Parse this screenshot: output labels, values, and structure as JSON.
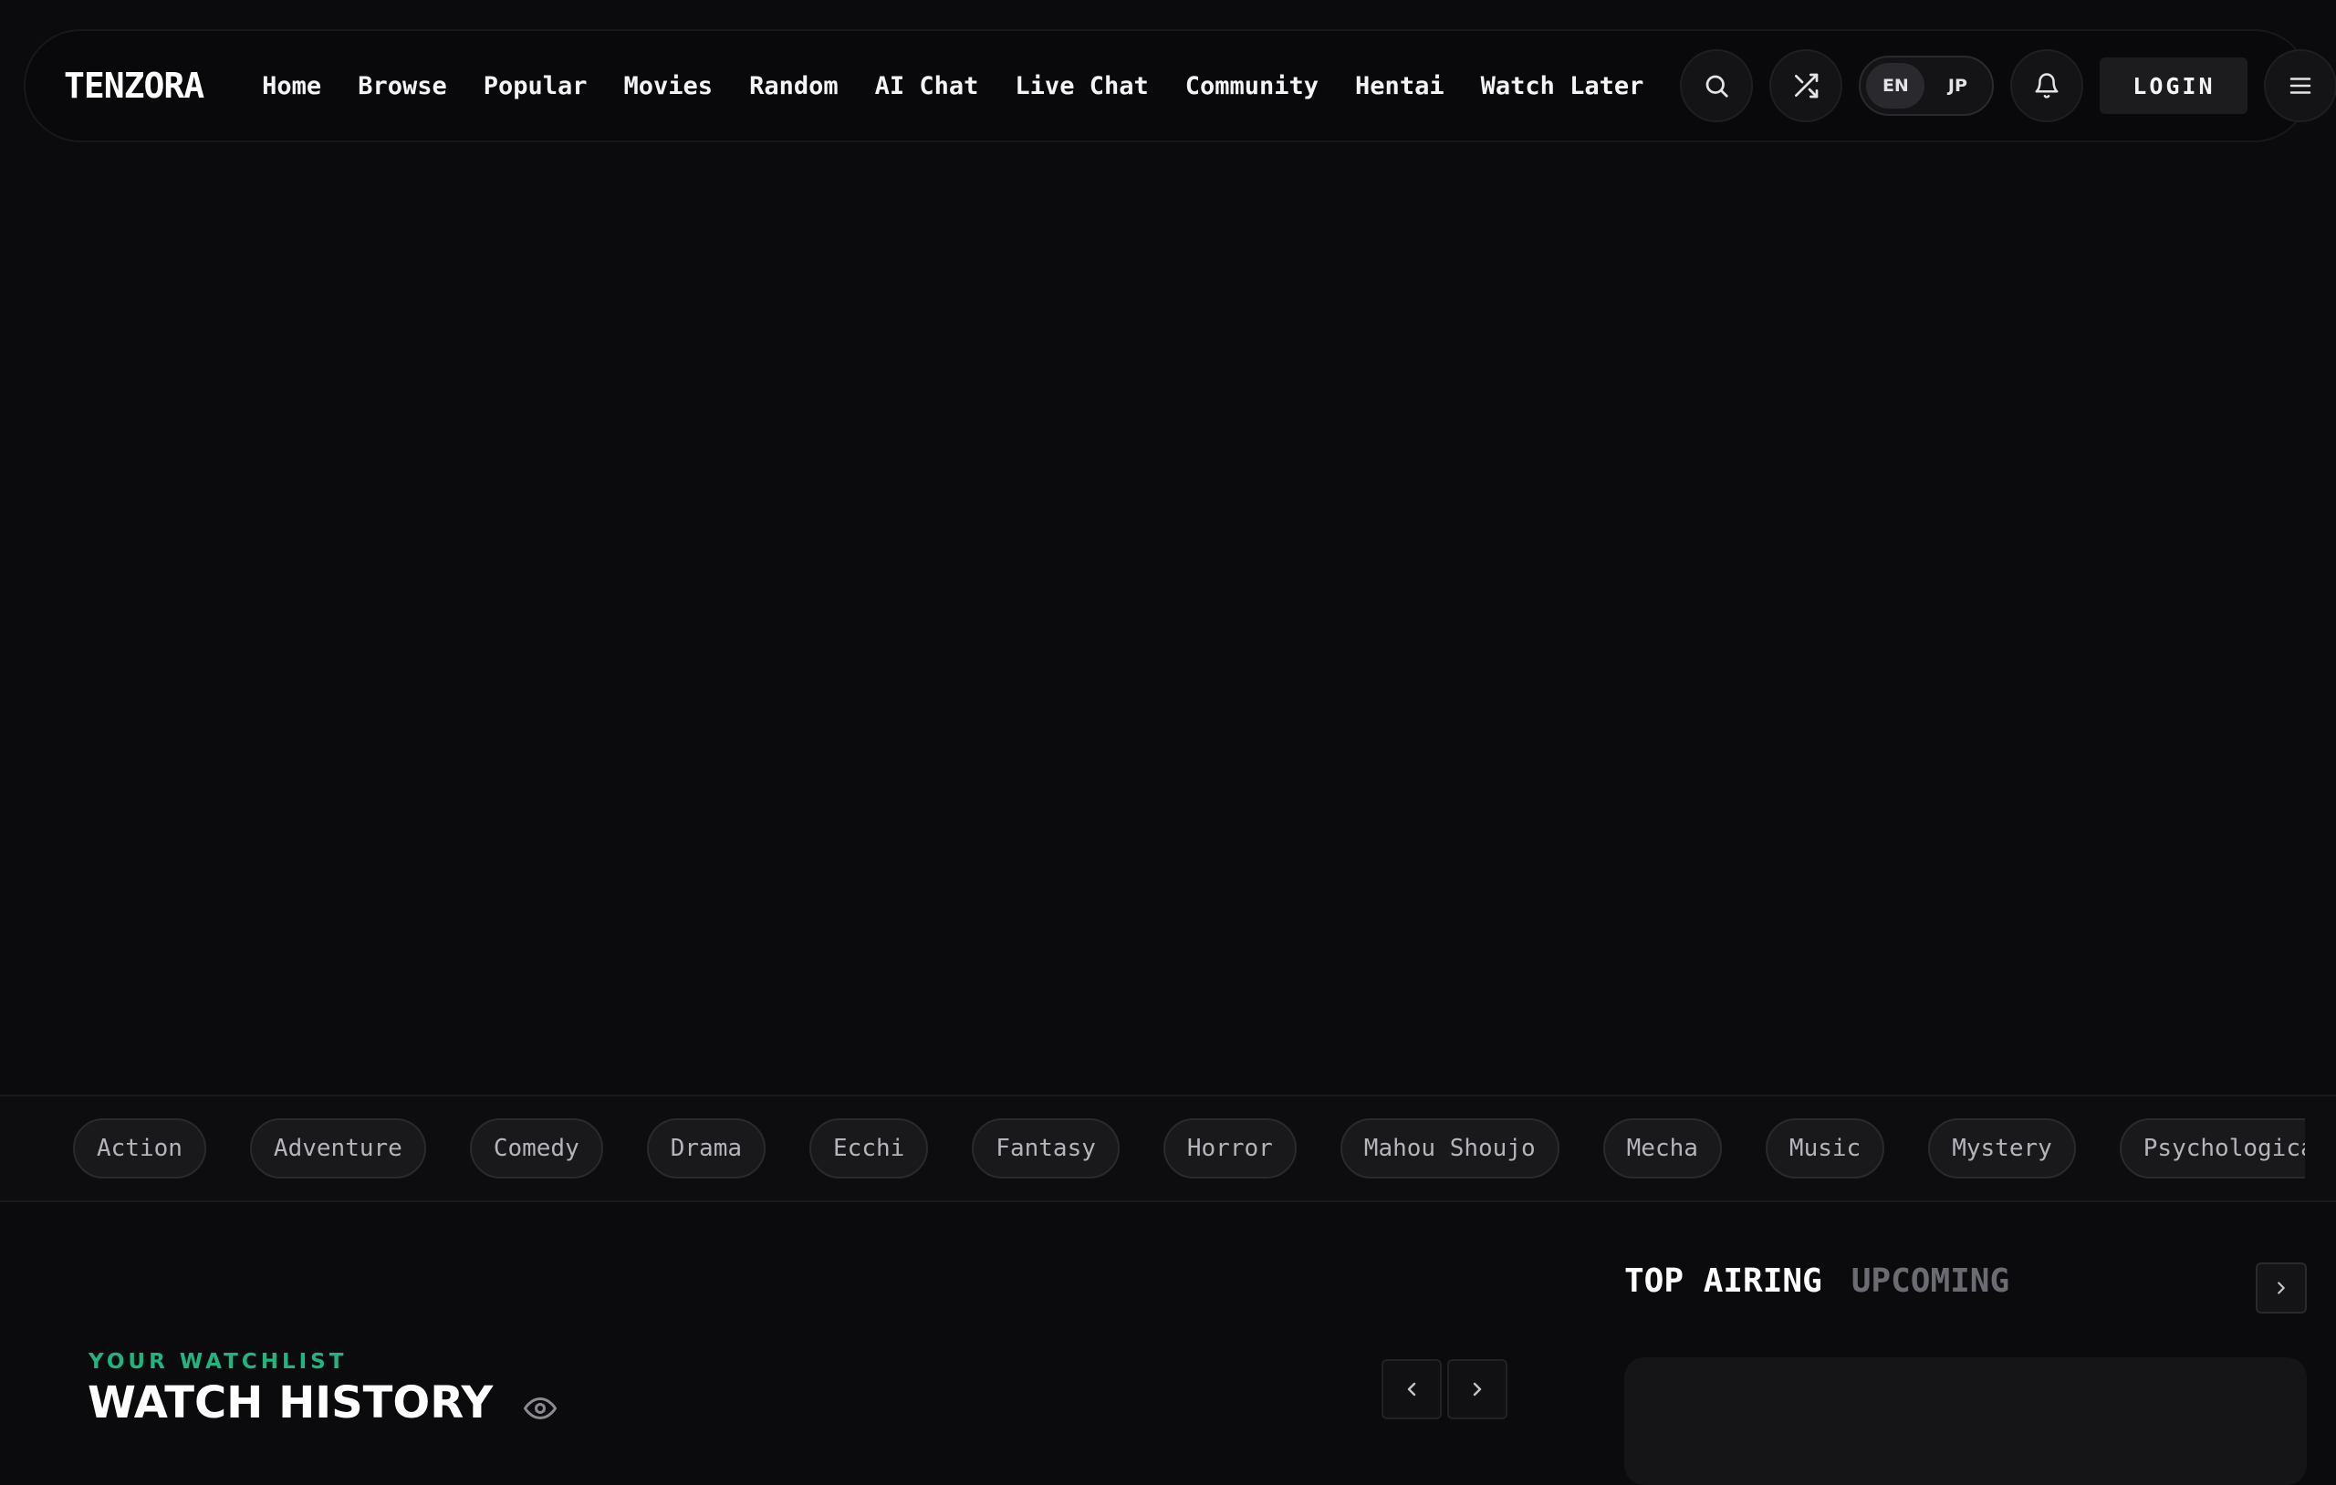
{
  "brand": "TENZORA",
  "nav": {
    "links": [
      "Home",
      "Browse",
      "Popular",
      "Movies",
      "Random",
      "AI Chat",
      "Live Chat",
      "Community",
      "Hentai",
      "Watch Later"
    ],
    "lang": {
      "en": "EN",
      "jp": "JP",
      "active": "EN"
    },
    "login_label": "LOGIN",
    "icons": [
      "search-icon",
      "shuffle-icon",
      "bell-icon",
      "menu-icon"
    ]
  },
  "genres": [
    "Action",
    "Adventure",
    "Comedy",
    "Drama",
    "Ecchi",
    "Fantasy",
    "Horror",
    "Mahou Shoujo",
    "Mecha",
    "Music",
    "Mystery",
    "Psychological"
  ],
  "watch_history": {
    "eyebrow": "YOUR WATCHLIST",
    "title": "WATCH HISTORY"
  },
  "top_airing": {
    "tabs": [
      "TOP AIRING",
      "UPCOMING"
    ],
    "active_tab": "TOP AIRING"
  },
  "colors": {
    "accent": "#1fb57f",
    "background": "#0b0b0d"
  }
}
